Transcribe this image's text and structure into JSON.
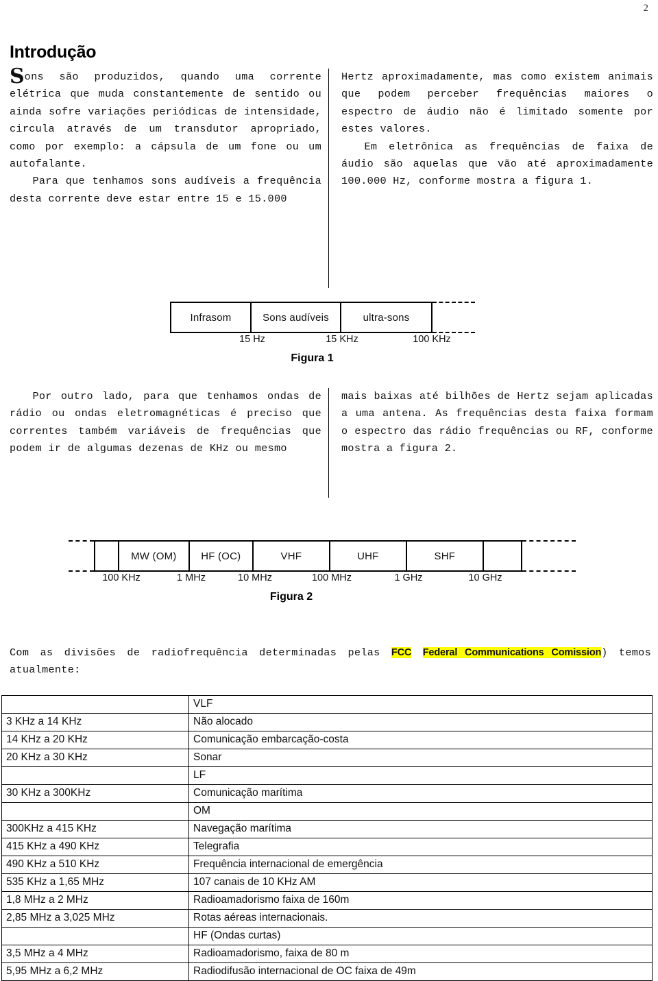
{
  "page": {
    "number": "2"
  },
  "heading": {
    "title": "Introdução"
  },
  "intro": {
    "dropcap": "S",
    "left_col": [
      "ons são produzidos, quando uma corrente elétrica que muda constantemente de sentido ou ainda sofre variações periódicas de intensidade, circula através de um transdutor apropriado, como por exemplo: a cápsula de um fone ou um autofalante.",
      "Para que tenhamos sons audíveis a frequência desta corrente deve estar entre 15 e 15.000"
    ],
    "right_col": [
      "Hertz aproximadamente, mas como existem animais que podem perceber frequências maiores o espectro de áudio não é limitado somente por estes valores.",
      "Em eletrônica as frequências de faixa de áudio são aquelas que vão até aproximadamente 100.000 Hz, conforme mostra a figura 1."
    ]
  },
  "radio": {
    "left_col": [
      "Por outro lado, para que tenhamos ondas de rádio ou ondas eletromagnéticas é preciso que correntes também variáveis de frequências que podem ir de algumas dezenas de KHz ou mesmo"
    ],
    "right_col": [
      "mais baixas até bilhões de Hertz sejam aplicadas a uma antena. As frequências desta faixa formam o espectro das rádio frequências ou RF, conforme mostra a figura 2."
    ]
  },
  "figure1": {
    "caption": "Figura 1",
    "bands": [
      "Infrasom",
      "Sons audíveis",
      "ultra-sons",
      ""
    ],
    "ticks": [
      "15 Hz",
      "15 KHz",
      "100 KHz"
    ]
  },
  "figure2": {
    "caption": "Figura 2",
    "bands": [
      "",
      "MW (OM)",
      "HF (OC)",
      "VHF",
      "UHF",
      "SHF",
      ""
    ],
    "ticks": [
      "100 KHz",
      "1 MHz",
      "10 MHz",
      "100 MHz",
      "1 GHz",
      "10 GHz"
    ]
  },
  "fcc_paragraph": {
    "lead": "Com as divisões de radiofrequência determinadas pelas ",
    "highlight1": "FCC",
    "highlight2": "Federal Communications Comission",
    "tail": ") temos atualmente:"
  },
  "table": {
    "rows": [
      {
        "range": "",
        "use": "VLF"
      },
      {
        "range": "3 KHz a 14 KHz",
        "use": "Não alocado"
      },
      {
        "range": "14 KHz a 20 KHz",
        "use": "Comunicação embarcação-costa"
      },
      {
        "range": "20 KHz a 30 KHz",
        "use": "Sonar"
      },
      {
        "range": "",
        "use": "LF"
      },
      {
        "range": "30 KHz a 300KHz",
        "use": "Comunicação marítima"
      },
      {
        "range": "",
        "use": "OM"
      },
      {
        "range": "300KHz a 415 KHz",
        "use": "Navegação marítima"
      },
      {
        "range": "415 KHz a 490 KHz",
        "use": "Telegrafia"
      },
      {
        "range": "490 KHz a 510 KHz",
        "use": "Frequência internacional de emergência"
      },
      {
        "range": "535 KHz a 1,65 MHz",
        "use": "107 canais de 10 KHz AM"
      },
      {
        "range": "1,8 MHz a 2 MHz",
        "use": "Radioamadorismo faixa de 160m"
      },
      {
        "range": "2,85 MHz a 3,025 MHz",
        "use": "Rotas aéreas internacionais."
      },
      {
        "range": "",
        "use": "HF  (Ondas curtas)"
      },
      {
        "range": "3,5 MHz a 4 MHz",
        "use": "Radioamadorismo, faixa de 80 m"
      },
      {
        "range": "5,95 MHz a 6,2 MHz",
        "use": "Radiodifusão internacional de OC faixa de 49m"
      }
    ]
  },
  "colors": {
    "highlight": "#ffff00",
    "text": "#111111",
    "rule": "#000000"
  }
}
